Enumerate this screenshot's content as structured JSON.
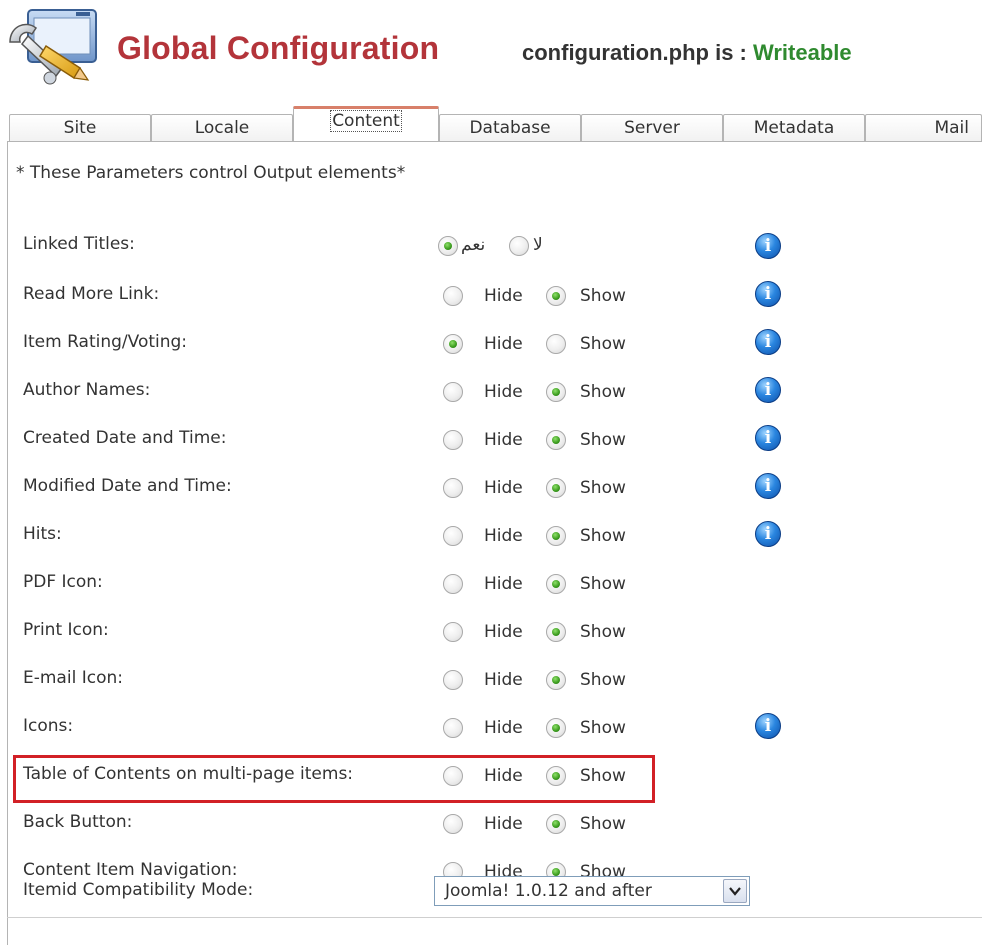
{
  "header": {
    "title": "Global Configuration",
    "status_prefix": "configuration.php is :",
    "status_value": "Writeable",
    "logo_icon": "config-wrench-icon"
  },
  "tabs": [
    {
      "label": "Site"
    },
    {
      "label": "Locale"
    },
    {
      "label": "Content",
      "active": true
    },
    {
      "label": "Database"
    },
    {
      "label": "Server"
    },
    {
      "label": "Metadata"
    },
    {
      "label": "Mail"
    }
  ],
  "content": {
    "description": "* These Parameters control Output elements*",
    "linked_titles": {
      "label": "Linked Titles:",
      "options": [
        "نعم",
        "لا"
      ],
      "selected": 0
    },
    "rows": [
      {
        "label": "Read More Link:",
        "hide": "Hide",
        "show": "Show",
        "selected": "show",
        "info": true
      },
      {
        "label": "Item Rating/Voting:",
        "hide": "Hide",
        "show": "Show",
        "selected": "hide",
        "info": true
      },
      {
        "label": "Author Names:",
        "hide": "Hide",
        "show": "Show",
        "selected": "show",
        "info": true
      },
      {
        "label": "Created Date and Time:",
        "hide": "Hide",
        "show": "Show",
        "selected": "show",
        "info": true
      },
      {
        "label": "Modified Date and Time:",
        "hide": "Hide",
        "show": "Show",
        "selected": "show",
        "info": true
      },
      {
        "label": "Hits:",
        "hide": "Hide",
        "show": "Show",
        "selected": "show",
        "info": true
      },
      {
        "label": "PDF Icon:",
        "hide": "Hide",
        "show": "Show",
        "selected": "show",
        "info": false
      },
      {
        "label": "Print Icon:",
        "hide": "Hide",
        "show": "Show",
        "selected": "show",
        "info": false
      },
      {
        "label": "E-mail Icon:",
        "hide": "Hide",
        "show": "Show",
        "selected": "show",
        "info": false
      },
      {
        "label": "Icons:",
        "hide": "Hide",
        "show": "Show",
        "selected": "show",
        "info": true
      },
      {
        "label": "Table of Contents on multi-page items:",
        "hide": "Hide",
        "show": "Show",
        "selected": "show",
        "info": false,
        "highlighted": true
      },
      {
        "label": "Back Button:",
        "hide": "Hide",
        "show": "Show",
        "selected": "show",
        "info": false
      },
      {
        "label": "Content Item Navigation:",
        "hide": "Hide",
        "show": "Show",
        "selected": "show",
        "info": false
      }
    ],
    "itemid_mode": {
      "label": "Itemid Compatibility Mode:",
      "value": "Joomla! 1.0.12 and after"
    },
    "info_icon_glyph": "i",
    "colors": {
      "title": "#b3343a",
      "writeable": "#2f8a2f",
      "highlight": "#d22026",
      "active_tab": "#d8806a"
    }
  }
}
